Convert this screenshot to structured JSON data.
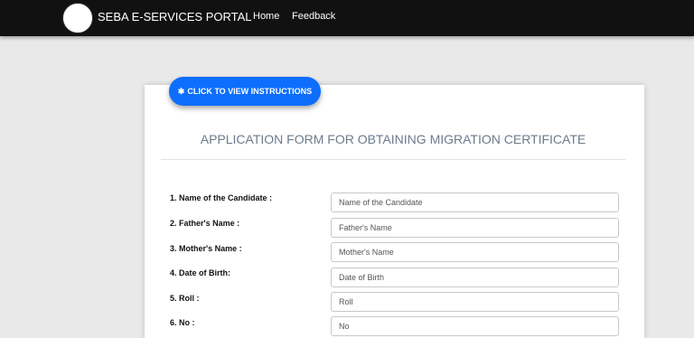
{
  "navbar": {
    "brand": "SEBA E-SERVICES PORTAL",
    "links": [
      "Home",
      "Feedback"
    ]
  },
  "instructions_button": {
    "icon": "✱",
    "label": "CLICK TO VIEW INSTRUCTIONS"
  },
  "form": {
    "title": "APPLICATION FORM FOR OBTAINING MIGRATION CERTIFICATE",
    "fields": [
      {
        "label": "1. Name of the Candidate :",
        "placeholder": "Name of the Candidate"
      },
      {
        "label": "2. Father's Name :",
        "placeholder": "Father's Name"
      },
      {
        "label": "3. Mother's Name :",
        "placeholder": "Mother's Name"
      },
      {
        "label": "4. Date of Birth:",
        "placeholder": "Date of Birth"
      },
      {
        "label": "5. Roll :",
        "placeholder": "Roll"
      },
      {
        "label": "6. No :",
        "placeholder": "No"
      }
    ]
  }
}
